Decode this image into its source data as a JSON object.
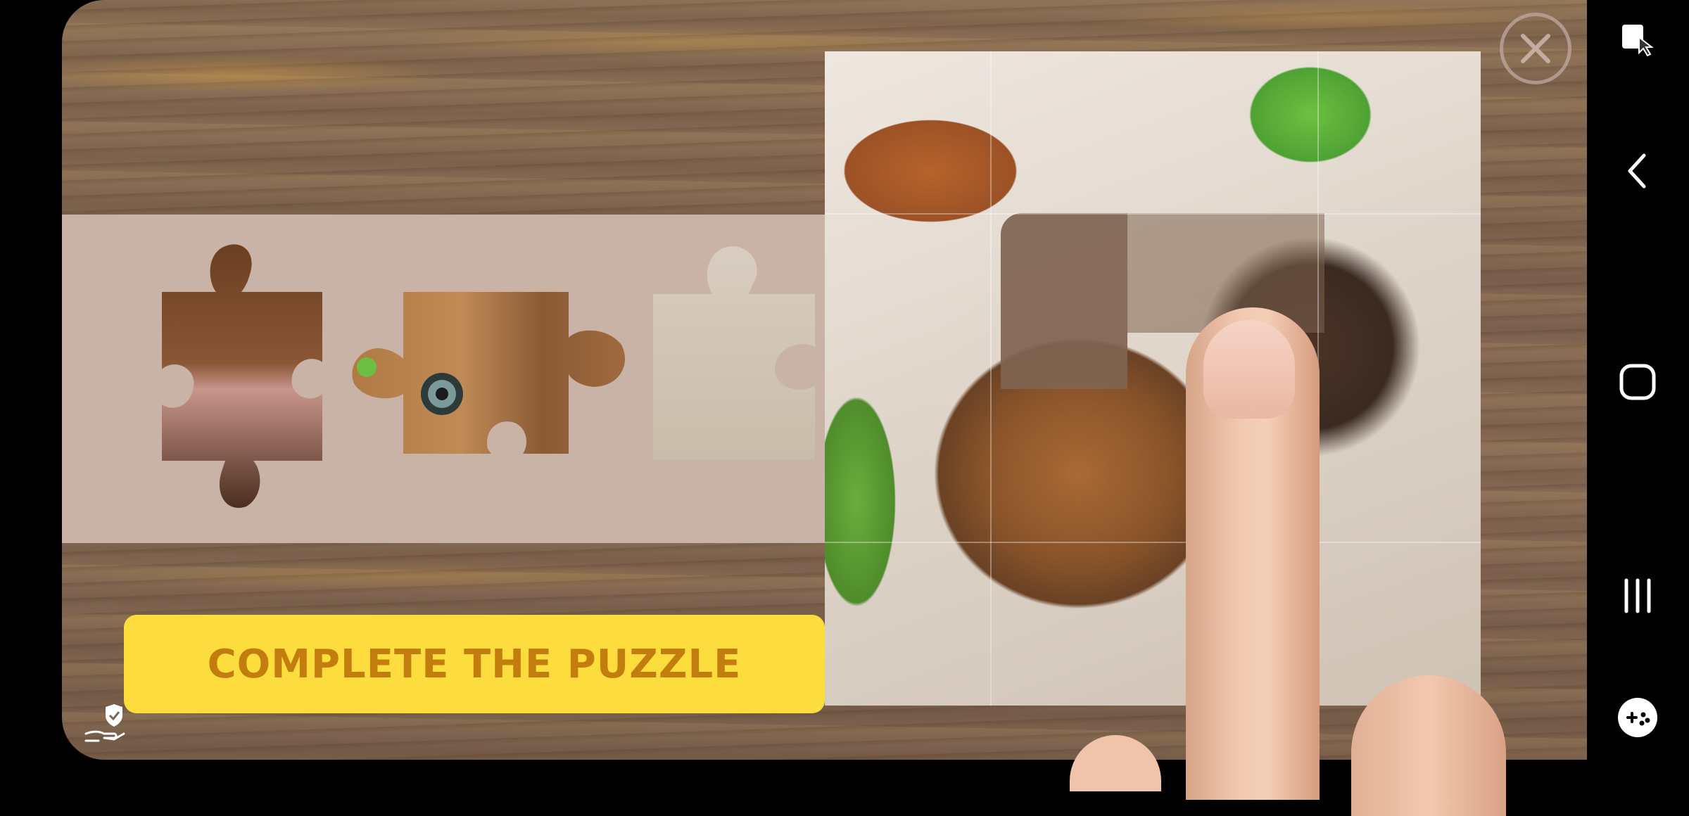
{
  "ad": {
    "cta_label": "COMPLETE THE PUZZLE",
    "close_icon": "close-icon",
    "privacy_icon": "hand-shield-icon"
  },
  "nav": {
    "icons": [
      "screenshot-touch-icon",
      "back-icon",
      "home-icon",
      "recents-icon",
      "game-booster-icon"
    ]
  },
  "colors": {
    "cta_bg": "#fddd3e",
    "cta_text": "#c27d0e",
    "tray": "#c9b3a7"
  }
}
